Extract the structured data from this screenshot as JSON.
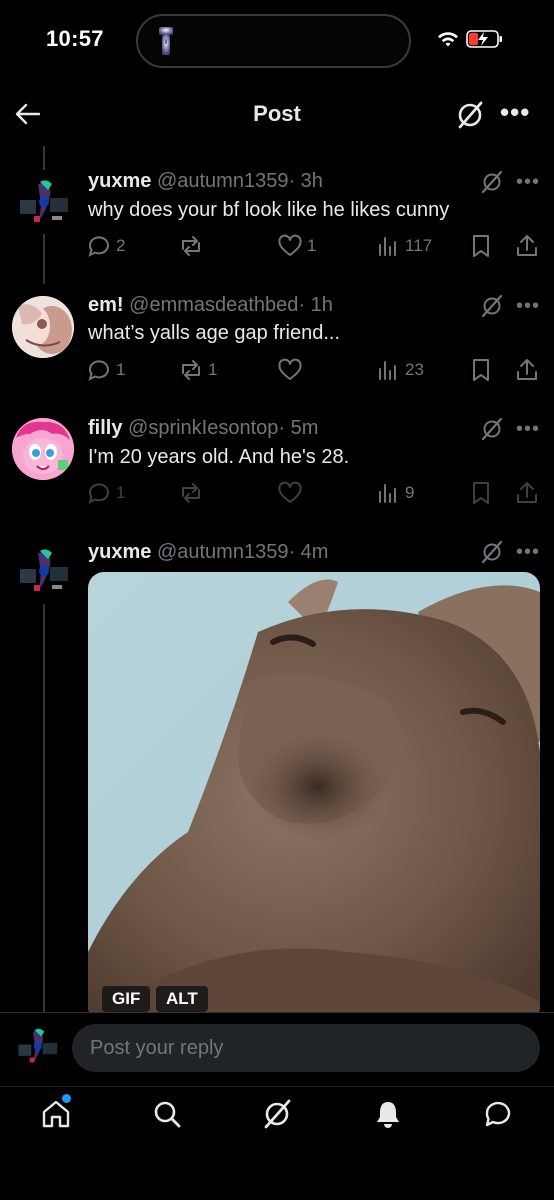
{
  "status_bar": {
    "time": "10:57"
  },
  "header": {
    "title": "Post"
  },
  "tweets": [
    {
      "name": "yuxme",
      "handle": "@autumn1359",
      "time": "· 3h",
      "text": "why does your bf look like he likes cunny",
      "replies": "2",
      "reposts": "",
      "likes": "1",
      "views": "117"
    },
    {
      "name": "em!",
      "handle": "@emmasdeathbed",
      "time": "· 1h",
      "text": "what’s yalls age gap friend...",
      "replies": "1",
      "reposts": "1",
      "likes": "",
      "views": "23"
    },
    {
      "name": "filly",
      "handle": "@sprinkIesontop",
      "time": "· 5m",
      "text": "I'm 20 years old. And he's 28.",
      "replies": "1",
      "reposts": "",
      "likes": "",
      "views": "9"
    },
    {
      "name": "yuxme",
      "handle": "@autumn1359",
      "time": "· 4m",
      "media": {
        "type": "gif",
        "gif_badge": "GIF",
        "alt_badge": "ALT"
      }
    }
  ],
  "reply": {
    "placeholder": "Post your reply"
  },
  "icons": {
    "back": "arrow-left-icon",
    "grok": "grok-icon",
    "more": "more-icon",
    "reply": "reply-icon",
    "repost": "repost-icon",
    "like": "heart-icon",
    "views": "views-icon",
    "bookmark": "bookmark-icon",
    "share": "share-icon",
    "nav": [
      "home-icon",
      "search-icon",
      "grok-icon",
      "bell-icon",
      "messages-icon"
    ]
  },
  "colors": {
    "accent": "#1d9bf0",
    "text": "#e7e9ea",
    "muted": "#71767b",
    "background": "#000000"
  }
}
